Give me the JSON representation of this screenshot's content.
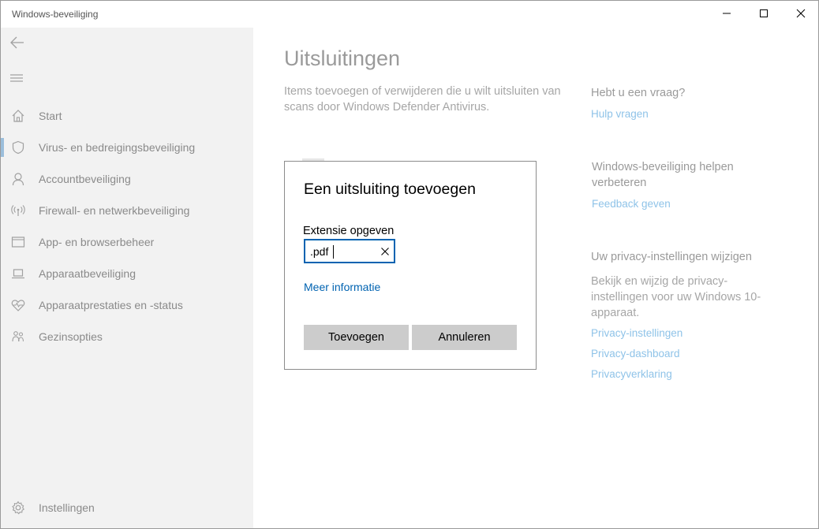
{
  "window": {
    "title": "Windows-beveiliging",
    "controls": {
      "minimize": "minimize-icon",
      "maximize": "maximize-icon",
      "close": "close-icon"
    }
  },
  "sidebar": {
    "back_icon": "back-arrow-icon",
    "menu_icon": "hamburger-icon",
    "items": [
      {
        "label": "Start",
        "icon": "home-icon",
        "selected": false
      },
      {
        "label": "Virus- en bedreigingsbeveiliging",
        "icon": "shield-icon",
        "selected": true
      },
      {
        "label": "Accountbeveiliging",
        "icon": "person-icon",
        "selected": false
      },
      {
        "label": "Firewall- en netwerkbeveiliging",
        "icon": "antenna-icon",
        "selected": false
      },
      {
        "label": "App- en browserbeheer",
        "icon": "app-window-icon",
        "selected": false
      },
      {
        "label": "Apparaatbeveiliging",
        "icon": "laptop-icon",
        "selected": false
      },
      {
        "label": "Apparaatprestaties en -status",
        "icon": "heart-pulse-icon",
        "selected": false
      },
      {
        "label": "Gezinsopties",
        "icon": "family-icon",
        "selected": false
      }
    ],
    "settings": {
      "label": "Instellingen",
      "icon": "gear-icon"
    }
  },
  "main": {
    "title": "Uitsluitingen",
    "description": "Items toevoegen of verwijderen die u wilt uitsluiten van scans door Windows Defender Antivirus."
  },
  "right": {
    "question": {
      "heading": "Hebt u een vraag?",
      "link": "Hulp vragen"
    },
    "improve": {
      "heading": "Windows-beveiliging helpen verbeteren",
      "link": "Feedback geven"
    },
    "privacy": {
      "heading": "Uw privacy-instellingen wijzigen",
      "text": "Bekijk en wijzig de privacy-instellingen voor uw Windows 10-apparaat.",
      "links": [
        "Privacy-instellingen",
        "Privacy-dashboard",
        "Privacyverklaring"
      ]
    }
  },
  "dialog": {
    "title": "Een uitsluiting toevoegen",
    "field_label": "Extensie opgeven",
    "field_value": ".pdf",
    "more_info": "Meer informatie",
    "add_button": "Toevoegen",
    "cancel_button": "Annuleren"
  },
  "colors": {
    "accent": "#0063b1",
    "sidebar_bg": "#f2f2f2",
    "selection_bar": "#9bbedb",
    "dimmed_link": "#8fc3e8",
    "button_bg": "#cccccc"
  }
}
